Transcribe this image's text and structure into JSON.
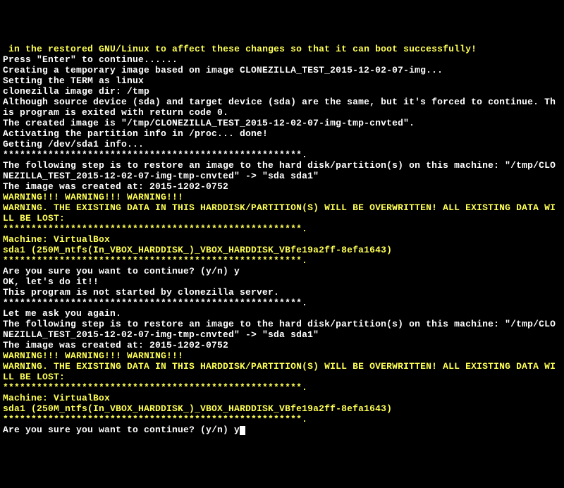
{
  "term": {
    "lines": [
      {
        "cls": "y",
        "t": " in the restored GNU/Linux to affect these changes so that it can boot successfully!"
      },
      {
        "cls": "l",
        "t": "Press \"Enter\" to continue......"
      },
      {
        "cls": "l",
        "t": "Creating a temporary image based on image CLONEZILLA_TEST_2015-12-02-07-img..."
      },
      {
        "cls": "l",
        "t": "Setting the TERM as linux"
      },
      {
        "cls": "l",
        "t": "clonezilla image dir: /tmp"
      },
      {
        "cls": "l",
        "t": "Although source device (sda) and target device (sda) are the same, but it's forced to continue. This program is exited with return code 0."
      },
      {
        "cls": "l",
        "t": "The created image is \"/tmp/CLONEZILLA_TEST_2015-12-02-07-img-tmp-cnvted\"."
      },
      {
        "cls": "l",
        "t": "Activating the partition info in /proc... done!"
      },
      {
        "cls": "l",
        "t": "Getting /dev/sda1 info..."
      },
      {
        "cls": "l",
        "t": "*****************************************************."
      },
      {
        "cls": "l",
        "t": "The following step is to restore an image to the hard disk/partition(s) on this machine: \"/tmp/CLONEZILLA_TEST_2015-12-02-07-img-tmp-cnvted\" -> \"sda sda1\""
      },
      {
        "cls": "l",
        "t": "The image was created at: 2015-1202-0752"
      },
      {
        "cls": "y",
        "t": "WARNING!!! WARNING!!! WARNING!!!"
      },
      {
        "cls": "y",
        "t": "WARNING. THE EXISTING DATA IN THIS HARDDISK/PARTITION(S) WILL BE OVERWRITTEN! ALL EXISTING DATA WILL BE LOST:"
      },
      {
        "cls": "y",
        "t": "*****************************************************."
      },
      {
        "cls": "y",
        "t": "Machine: VirtualBox"
      },
      {
        "cls": "y",
        "t": "sda1 (250M_ntfs(In_VBOX_HARDDISK_)_VBOX_HARDDISK_VBfe19a2ff-8efa1643)"
      },
      {
        "cls": "y",
        "t": "*****************************************************."
      },
      {
        "cls": "l",
        "t": "Are you sure you want to continue? (y/n) y"
      },
      {
        "cls": "l",
        "t": "OK, let's do it!!"
      },
      {
        "cls": "l",
        "t": "This program is not started by clonezilla server."
      },
      {
        "cls": "l",
        "t": "*****************************************************."
      },
      {
        "cls": "l",
        "t": "Let me ask you again."
      },
      {
        "cls": "l",
        "t": "The following step is to restore an image to the hard disk/partition(s) on this machine: \"/tmp/CLONEZILLA_TEST_2015-12-02-07-img-tmp-cnvted\" -> \"sda sda1\""
      },
      {
        "cls": "l",
        "t": "The image was created at: 2015-1202-0752"
      },
      {
        "cls": "y",
        "t": "WARNING!!! WARNING!!! WARNING!!!"
      },
      {
        "cls": "y",
        "t": "WARNING. THE EXISTING DATA IN THIS HARDDISK/PARTITION(S) WILL BE OVERWRITTEN! ALL EXISTING DATA WILL BE LOST:"
      },
      {
        "cls": "y",
        "t": "*****************************************************."
      },
      {
        "cls": "y",
        "t": "Machine: VirtualBox"
      },
      {
        "cls": "y",
        "t": "sda1 (250M_ntfs(In_VBOX_HARDDISK_)_VBOX_HARDDISK_VBfe19a2ff-8efa1643)"
      },
      {
        "cls": "y",
        "t": "*****************************************************."
      },
      {
        "cls": "l",
        "t": "Are you sure you want to continue? (y/n) y"
      }
    ],
    "prompt_input": "y"
  }
}
